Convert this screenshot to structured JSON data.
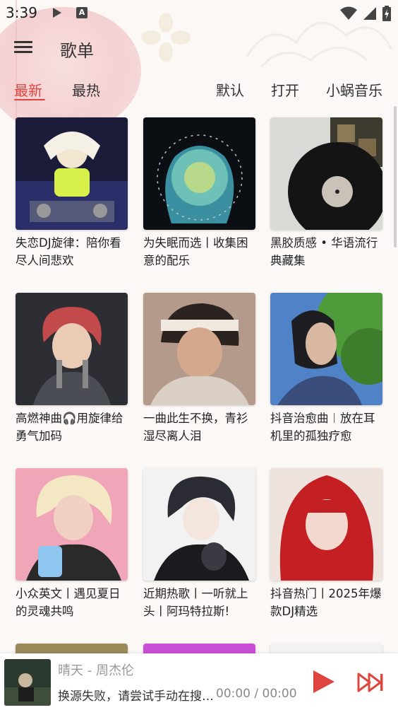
{
  "status_bar": {
    "time": "3:39",
    "icons": [
      "play-icon",
      "a-notification-icon",
      "wifi-icon",
      "signal-icon",
      "battery-charging-icon"
    ]
  },
  "header": {
    "title": "歌单",
    "menu_icon": "hamburger-menu-icon"
  },
  "tabs": [
    {
      "label": "最新",
      "active": true
    },
    {
      "label": "最热",
      "active": false
    },
    {
      "label": "默认",
      "active": false
    },
    {
      "label": "打开",
      "active": false
    },
    {
      "label": "小蜗音乐",
      "active": false
    }
  ],
  "playlists": [
    {
      "title": "失恋DJ旋律：陪你看尽人间悲欢"
    },
    {
      "title": "为失眠而选丨收集困意的配乐"
    },
    {
      "title": "黑胶质感 • 华语流行典藏集"
    },
    {
      "title": "高燃神曲🎧用旋律给勇气加码"
    },
    {
      "title": "一曲此生不换，青衫湿尽离人泪"
    },
    {
      "title": "抖音治愈曲︱放在耳机里的孤独疗愈"
    },
    {
      "title": "小众英文丨遇见夏日的灵魂共鸣"
    },
    {
      "title": "近期热歌丨一听就上头丨阿玛特拉斯!"
    },
    {
      "title": "抖音热门丨2025年爆款DJ精选"
    }
  ],
  "player": {
    "song": "晴天 - 周杰伦",
    "status": "换源失败，请尝试手动在搜索页面换源",
    "time": "00:00 / 00:00",
    "accent": "#e0453d"
  }
}
